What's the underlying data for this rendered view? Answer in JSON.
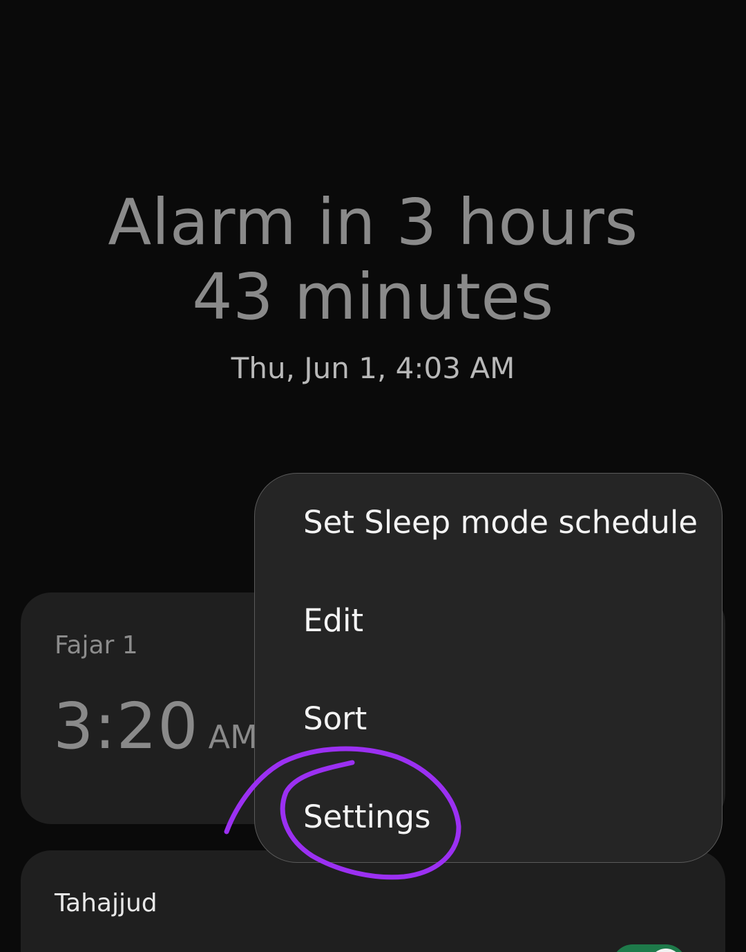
{
  "header": {
    "countdown_line1": "Alarm in 3 hours",
    "countdown_line2": "43 minutes",
    "next_alarm_date": "Thu, Jun 1, 4:03 AM"
  },
  "alarms": [
    {
      "name": "Fajar 1",
      "time": "3:20",
      "ampm": "AM"
    },
    {
      "name": "Tahajjud",
      "enabled": true
    }
  ],
  "menu": {
    "items": [
      "Set Sleep mode schedule",
      "Edit",
      "Sort",
      "Settings"
    ]
  },
  "colors": {
    "background": "#0a0a0a",
    "card": "#1f1f1f",
    "menu": "#252525",
    "annotation": "#9b30f2",
    "toggle_on": "#1e7a4a"
  },
  "annotation": {
    "type": "hand-drawn circle",
    "target": "Settings"
  }
}
